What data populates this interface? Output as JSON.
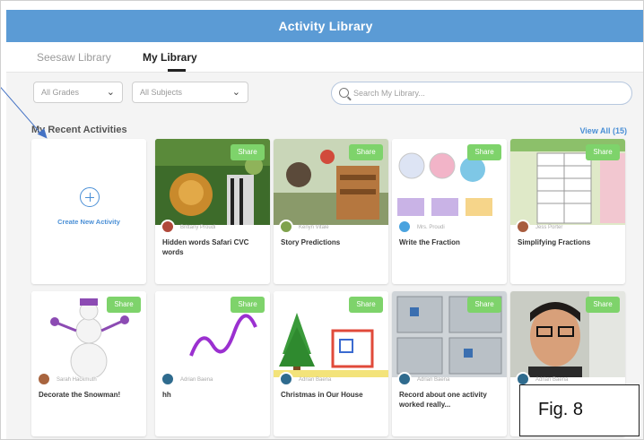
{
  "header": {
    "title": "Activity Library"
  },
  "tabs": [
    {
      "label": "Seesaw Library",
      "active": false
    },
    {
      "label": "My Library",
      "active": true
    }
  ],
  "filters": {
    "grades": {
      "label": "All Grades"
    },
    "subjects": {
      "label": "All Subjects"
    },
    "search": {
      "placeholder": "Search My Library..."
    }
  },
  "section": {
    "title": "My Recent Activities",
    "view_all": "View All (15)"
  },
  "create_card": {
    "label": "Create New Activity"
  },
  "cards": [
    {
      "title": "Hidden words Safari CVC words",
      "author": "Brittany Proudi",
      "share": "Share"
    },
    {
      "title": "Story Predictions",
      "author": "Kenyn Vitale",
      "share": "Share"
    },
    {
      "title": "Write the Fraction",
      "author": "Mrs. Proudi",
      "share": "Share"
    },
    {
      "title": "Simplifying Fractions",
      "author": "Jess Porter",
      "share": "Share"
    },
    {
      "title": "Decorate the Snowman!",
      "author": "Sarah Hackmuth",
      "share": "Share"
    },
    {
      "title": "hh",
      "author": "Adrian Baena",
      "share": "Share"
    },
    {
      "title": "Christmas in Our House",
      "author": "Adrian Baena",
      "share": "Share"
    },
    {
      "title": "Record about one activity worked really...",
      "author": "Adrian Baena",
      "share": "Share"
    },
    {
      "title": "",
      "author": "Adrian Baena",
      "share": "Share"
    }
  ],
  "figure_label": "Fig. 8",
  "colors": {
    "header": "#5b9bd5",
    "accent": "#4a8fd6",
    "share": "#7ed36b"
  }
}
